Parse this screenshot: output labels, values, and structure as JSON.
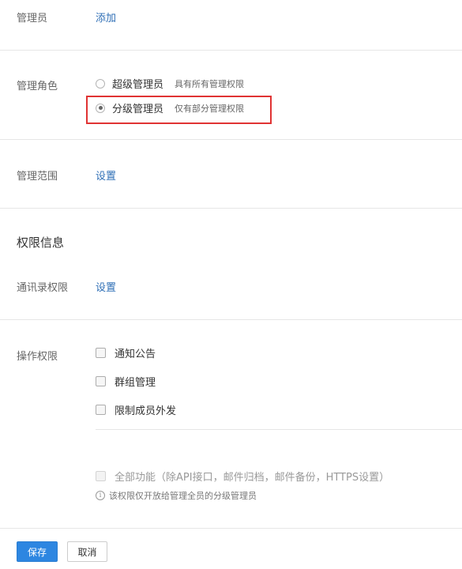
{
  "admin": {
    "label": "管理员",
    "action": "添加"
  },
  "role": {
    "label": "管理角色",
    "options": [
      {
        "title": "超级管理员",
        "desc": "具有所有管理权限",
        "checked": false
      },
      {
        "title": "分级管理员",
        "desc": "仅有部分管理权限",
        "checked": true
      }
    ]
  },
  "scope": {
    "label": "管理范围",
    "action": "设置"
  },
  "permissions_section": {
    "title": "权限信息"
  },
  "contacts": {
    "label": "通讯录权限",
    "action": "设置"
  },
  "operations": {
    "label": "操作权限",
    "items": [
      {
        "label": "通知公告",
        "checked": false
      },
      {
        "label": "群组管理",
        "checked": false
      },
      {
        "label": "限制成员外发",
        "checked": false
      }
    ],
    "all_features": {
      "label": "全部功能（除API接口，邮件归档，邮件备份，HTTPS设置）",
      "checked": false,
      "disabled": true
    },
    "note": "该权限仅开放给管理全员的分级管理员"
  },
  "buttons": {
    "save": "保存",
    "cancel": "取消"
  },
  "colors": {
    "link": "#2f6fb6",
    "primary": "#2d86e1",
    "highlight": "#e03333"
  }
}
